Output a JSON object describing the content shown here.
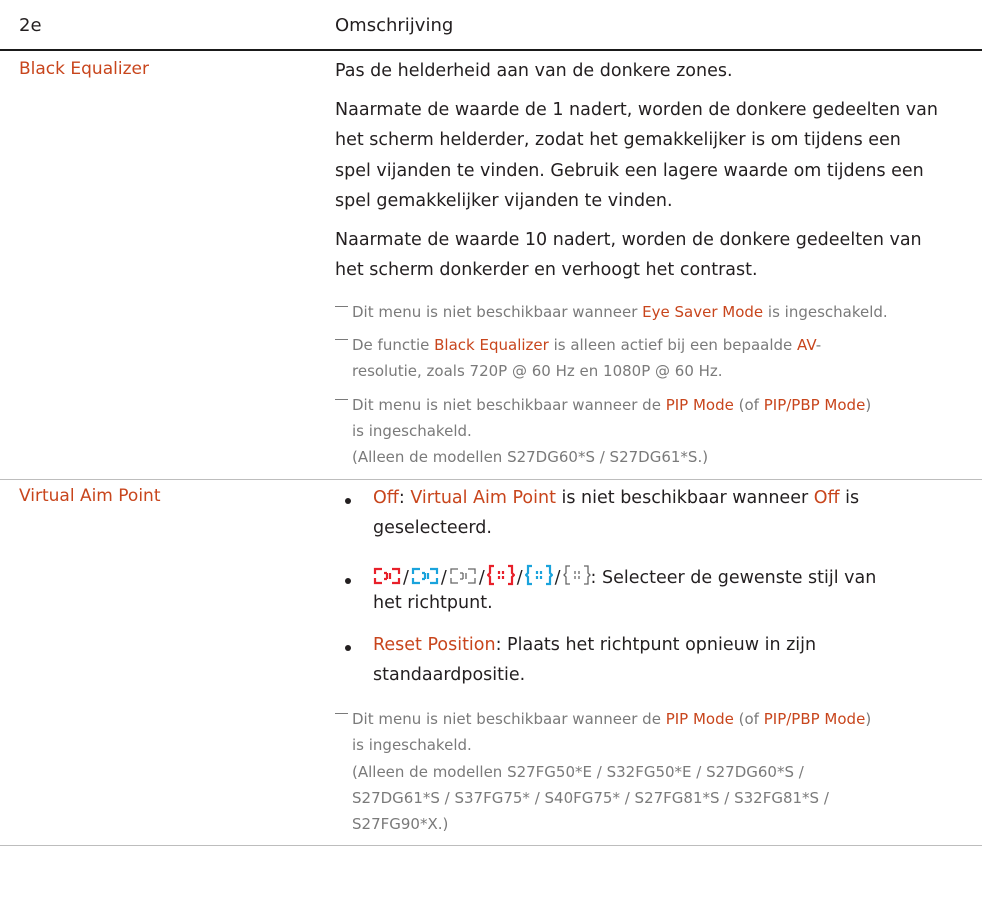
{
  "header": {
    "col1": "2e",
    "col2": "Omschrijving"
  },
  "rows": [
    {
      "term": "Black Equalizer",
      "p1": "Pas de helderheid aan van de donkere zones.",
      "p2_lines": [
        "Naarmate de waarde de 1 nadert, worden de donkere gedeelten van",
        "het scherm helderder, zodat het gemakkelijker is om tijdens een",
        "spel vijanden te vinden. Gebruik een lagere waarde om tijdens een",
        "spel gemakkelijker vijanden te vinden."
      ],
      "p3_lines": [
        "Naarmate de waarde 10 nadert, worden de donkere gedeelten van",
        "het scherm donkerder en verhoogt het contrast."
      ],
      "note1": {
        "pre": "Dit menu is niet beschikbaar wanneer ",
        "hl": "Eye Saver Mode",
        "post": " is ingeschakeld."
      },
      "note2": {
        "pre": "De functie ",
        "hl1": "Black Equalizer",
        "mid": " is alleen actief bij een bepaalde ",
        "hl2": "AV",
        "post": "-",
        "line2": "resolutie, zoals 720P @ 60 Hz en 1080P @ 60 Hz."
      },
      "note3": {
        "pre": "Dit menu is niet beschikbaar wanneer de ",
        "hl1": "PIP Mode",
        "mid": " (of ",
        "hl2": "PIP/PBP Mode",
        "post": ")",
        "line2": "is ingeschakeld.",
        "line3": "(Alleen de modellen S27DG60*S / S27DG61*S.)"
      }
    },
    {
      "term": "Virtual Aim Point",
      "b1": {
        "hl1": "Off",
        "mid": ": ",
        "hl2": "Virtual Aim Point",
        "mid2": " is niet beschikbaar wanneer ",
        "hl3": "Off",
        "post": " is",
        "line2": "geselecteerd."
      },
      "b2": {
        "sep": "/",
        "text": ": Selecteer de gewenste stijl van",
        "line2": "het richtpunt."
      },
      "b3": {
        "hl": "Reset Position",
        "text": ": Plaats het richtpunt opnieuw in zijn",
        "line2": "standaardpositie."
      },
      "note": {
        "pre": "Dit menu is niet beschikbaar wanneer de ",
        "hl1": "PIP Mode",
        "mid": " (of ",
        "hl2": "PIP/PBP Mode",
        "post": ")",
        "line2": "is ingeschakeld.",
        "line3": "(Alleen de modellen S27FG50*E / S32FG50*E / S27DG60*S /",
        "line4": "S27DG61*S / S37FG75* / S40FG75* / S27FG81*S / S32FG81*S /",
        "line5": "S27FG90*X.)"
      }
    }
  ],
  "colors": {
    "accent": "#c8451c",
    "text": "#231f20",
    "note": "#7a7a7a",
    "icon_red": "#e8202a",
    "icon_blue": "#1aa3dc",
    "icon_gray": "#666666"
  },
  "icons": [
    "crosshair-red-icon",
    "crosshair-blue-icon",
    "crosshair-gray-icon",
    "bracket-red-icon",
    "bracket-blue-icon",
    "bracket-gray-icon"
  ]
}
